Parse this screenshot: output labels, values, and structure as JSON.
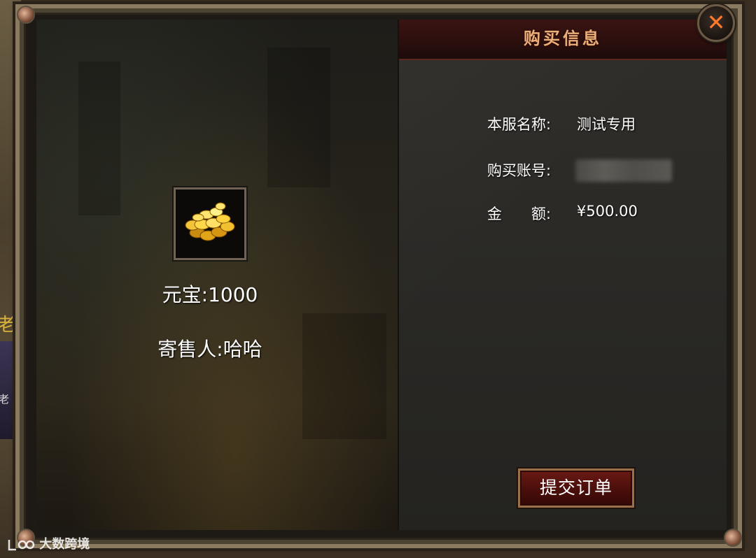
{
  "header": {
    "title": "购买信息"
  },
  "close_icon_glyph": "✕",
  "item": {
    "icon": "gold-coins-icon",
    "name": "元宝:1000",
    "seller": "寄售人:哈哈"
  },
  "info": {
    "server_label": "本服名称:",
    "server_value": "测试专用",
    "account_label": "购买账号:",
    "amount_label": "金　　额:",
    "amount_value": "¥500.00"
  },
  "submit_label": "提交订单",
  "background_glyphs": {
    "top": "老",
    "bottom": "老"
  },
  "watermark": {
    "text": "大数跨境"
  },
  "colors": {
    "title": "#e9b07a",
    "close": "#ff7a2a",
    "button_bg": "#4a0e0b",
    "text": "#ffffff"
  }
}
